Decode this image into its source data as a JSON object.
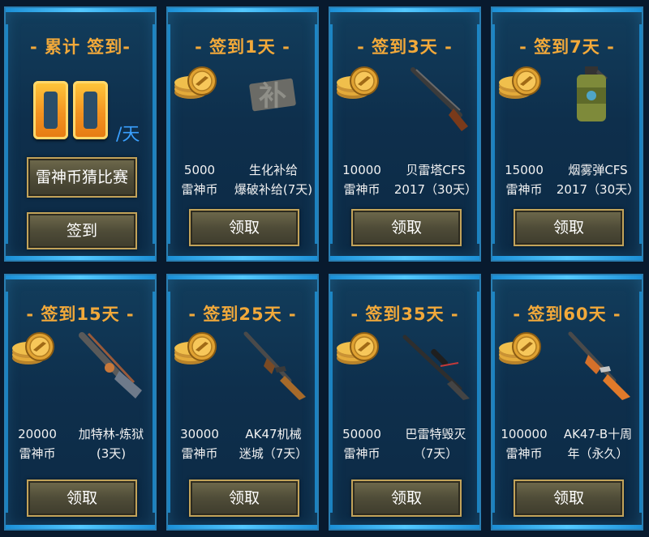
{
  "summary": {
    "title": "- 累计 签到-",
    "days_value": "00",
    "per_day_label": "/天",
    "guess_button": "雷神币猜比赛",
    "signin_button": "签到"
  },
  "cards": [
    {
      "title": "- 签到1天 -",
      "reward_left": [
        "5000",
        "雷神币"
      ],
      "reward_right": [
        "生化补给",
        "爆破补给(7天)"
      ],
      "item_icon": "supply-patch-icon",
      "button": "领取"
    },
    {
      "title": "- 签到3天 -",
      "reward_left": [
        "10000",
        "雷神币"
      ],
      "reward_right": [
        "贝雷塔CFS",
        "2017（30天）"
      ],
      "item_icon": "shotgun-icon",
      "button": "领取"
    },
    {
      "title": "- 签到7天 -",
      "reward_left": [
        "15000",
        "雷神币"
      ],
      "reward_right": [
        "烟雾弹CFS",
        "2017（30天）"
      ],
      "item_icon": "smoke-grenade-icon",
      "button": "领取"
    },
    {
      "title": "- 签到15天 -",
      "reward_left": [
        "20000",
        "雷神币"
      ],
      "reward_right": [
        "加特林-炼狱",
        "(3天)"
      ],
      "item_icon": "gatling-gun-icon",
      "button": "领取"
    },
    {
      "title": "- 签到25天 -",
      "reward_left": [
        "30000",
        "雷神币"
      ],
      "reward_right": [
        "AK47机械",
        "迷城（7天）"
      ],
      "item_icon": "ak47-rifle-icon",
      "button": "领取"
    },
    {
      "title": "- 签到35天 -",
      "reward_left": [
        "50000",
        "雷神币"
      ],
      "reward_right": [
        "巴雷特毁灭",
        "（7天）"
      ],
      "item_icon": "sniper-rifle-icon",
      "button": "领取"
    },
    {
      "title": "- 签到60天 -",
      "reward_left": [
        "100000",
        "雷神币"
      ],
      "reward_right": [
        "AK47-B十周",
        "年（永久）"
      ],
      "item_icon": "ak47-b-rifle-icon",
      "button": "领取"
    }
  ],
  "colors": {
    "title": "#f2a93a",
    "border": "#2a7fb3",
    "per_day": "#3aa0ff"
  }
}
